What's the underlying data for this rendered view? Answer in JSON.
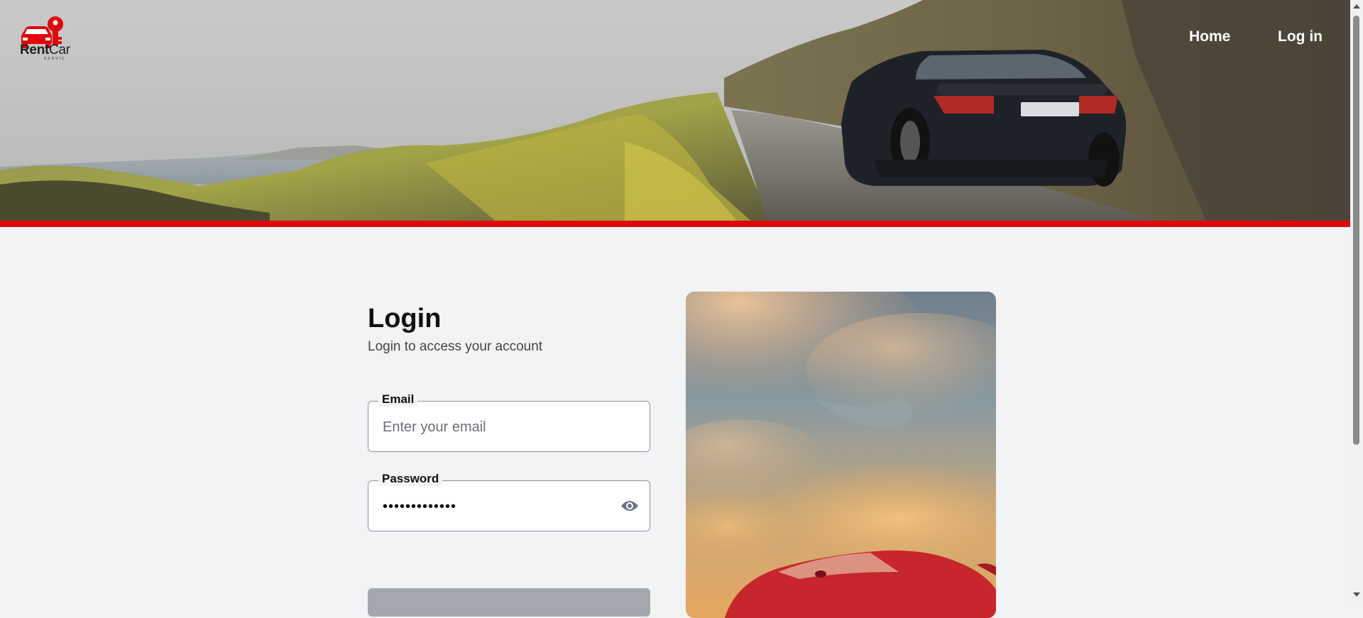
{
  "header": {
    "logo": {
      "text_bold": "Rent",
      "text_regular": "Car",
      "subtext": "SERVIC"
    },
    "nav": [
      {
        "label": "Home"
      },
      {
        "label": "Log in"
      }
    ],
    "accent_color": "#e0070c"
  },
  "login": {
    "title": "Login",
    "subtitle": "Login to access your account",
    "email": {
      "label": "Email",
      "placeholder": "Enter your email",
      "value": ""
    },
    "password": {
      "label": "Password",
      "value": "•••••••••••••"
    },
    "icons": [
      "eye-icon"
    ]
  }
}
